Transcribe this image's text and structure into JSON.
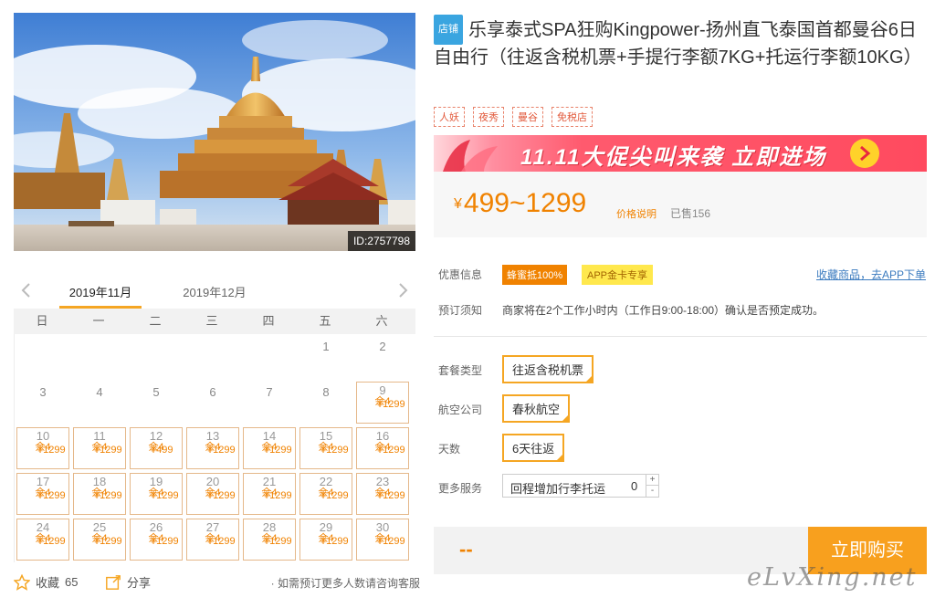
{
  "hero": {
    "id_label": "ID:2757798"
  },
  "calendar": {
    "prev_month_glyph": "‹",
    "next_month_glyph": "›",
    "active_month": "2019年11月",
    "next_month": "2019年12月",
    "weekdays": [
      "日",
      "一",
      "二",
      "三",
      "四",
      "五",
      "六"
    ],
    "days": [
      {
        "d": "",
        "p": "",
        "r": ""
      },
      {
        "d": "",
        "p": "",
        "r": ""
      },
      {
        "d": "",
        "p": "",
        "r": ""
      },
      {
        "d": "",
        "p": "",
        "r": ""
      },
      {
        "d": "",
        "p": "",
        "r": ""
      },
      {
        "d": "1",
        "p": "",
        "r": ""
      },
      {
        "d": "2",
        "p": "",
        "r": ""
      },
      {
        "d": "3",
        "p": "",
        "r": ""
      },
      {
        "d": "4",
        "p": "",
        "r": ""
      },
      {
        "d": "5",
        "p": "",
        "r": ""
      },
      {
        "d": "6",
        "p": "",
        "r": ""
      },
      {
        "d": "7",
        "p": "",
        "r": ""
      },
      {
        "d": "8",
        "p": "",
        "r": ""
      },
      {
        "d": "9",
        "p": "¥1299",
        "r": "余4"
      },
      {
        "d": "10",
        "p": "¥1299",
        "r": "余4"
      },
      {
        "d": "11",
        "p": "¥1299",
        "r": "余4"
      },
      {
        "d": "12",
        "p": "¥499",
        "r": "余4"
      },
      {
        "d": "13",
        "p": "¥1299",
        "r": "余4"
      },
      {
        "d": "14",
        "p": "¥1299",
        "r": "余4"
      },
      {
        "d": "15",
        "p": "¥1299",
        "r": "余4"
      },
      {
        "d": "16",
        "p": "¥1299",
        "r": "余4"
      },
      {
        "d": "17",
        "p": "¥1299",
        "r": "余4"
      },
      {
        "d": "18",
        "p": "¥1299",
        "r": "余4"
      },
      {
        "d": "19",
        "p": "¥1299",
        "r": "余4"
      },
      {
        "d": "20",
        "p": "¥1299",
        "r": "余4"
      },
      {
        "d": "21",
        "p": "¥1299",
        "r": "余4"
      },
      {
        "d": "22",
        "p": "¥1299",
        "r": "余4"
      },
      {
        "d": "23",
        "p": "¥1299",
        "r": "余4"
      },
      {
        "d": "24",
        "p": "¥1299",
        "r": "余4"
      },
      {
        "d": "25",
        "p": "¥1299",
        "r": "余4"
      },
      {
        "d": "26",
        "p": "¥1299",
        "r": "余4"
      },
      {
        "d": "27",
        "p": "¥1299",
        "r": "余4"
      },
      {
        "d": "28",
        "p": "¥1299",
        "r": "余4"
      },
      {
        "d": "29",
        "p": "¥1299",
        "r": "余4"
      },
      {
        "d": "30",
        "p": "¥1299",
        "r": "余4"
      }
    ]
  },
  "actions": {
    "fav_label": "收藏",
    "fav_count": "65",
    "share_label": "分享",
    "consult": "· 如需预订更多人数请咨询客服"
  },
  "product": {
    "store_badge": "店铺",
    "title": "乐享泰式SPA狂购Kingpower-扬州直飞泰国首都曼谷6日自由行（往返含税机票+手提行李额7KG+托运行李额10KG）",
    "tags": [
      "人妖",
      "夜秀",
      "曼谷",
      "免税店"
    ]
  },
  "banner": {
    "text": "11.11大促尖叫来袭  立即进场"
  },
  "price": {
    "currency": "¥",
    "range": "499~1299",
    "note": "价格说明",
    "sold": "已售156"
  },
  "info": {
    "promo_label": "优惠信息",
    "promo_tag1": "蜂蜜抵100%",
    "promo_tag2": "APP金卡专享",
    "app_link": "收藏商品，去APP下单",
    "notice_label": "预订须知",
    "notice_text": "商家将在2个工作小时内（工作日9:00-18:00）确认是否预定成功。"
  },
  "options": {
    "package_label": "套餐类型",
    "package_value": "往返含税机票",
    "airline_label": "航空公司",
    "airline_value": "春秋航空",
    "days_label": "天数",
    "days_value": "6天往返",
    "more_label": "更多服务",
    "more_value": "回程增加行李托运",
    "more_qty": "0",
    "plus": "+",
    "minus": "-"
  },
  "buy": {
    "total": "--",
    "button": "立即购买"
  },
  "watermark": "eLvXing.net",
  "colors": {
    "accent_orange": "#f08200",
    "button_orange": "#f8a01e",
    "banner_red": "#ff4a5f",
    "link_blue": "#3b7bbf"
  }
}
